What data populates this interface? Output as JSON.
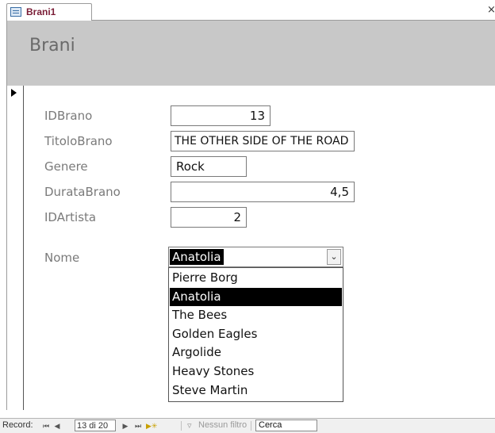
{
  "tab": {
    "label": "Brani1",
    "icon": "form-icon",
    "close": "×"
  },
  "form": {
    "title": "Brani",
    "fields": [
      {
        "label": "IDBrano",
        "value": "13"
      },
      {
        "label": "TitoloBrano",
        "value": "THE OTHER SIDE OF THE ROAD"
      },
      {
        "label": "Genere",
        "value": "Rock"
      },
      {
        "label": "DurataBrano",
        "value": "4,5"
      },
      {
        "label": "IDArtista",
        "value": "2"
      }
    ],
    "combo": {
      "label": "Nome",
      "value": "Anatolia",
      "options": [
        "Pierre Borg",
        "Anatolia",
        "The Bees",
        "Golden Eagles",
        "Argolide",
        "Heavy Stones",
        "Steve Martin"
      ],
      "selected_index": 1
    }
  },
  "navigation": {
    "record_label": "Record:",
    "current": "13 di 20",
    "filter_label": "Nessun filtro",
    "search_label": "Cerca"
  }
}
